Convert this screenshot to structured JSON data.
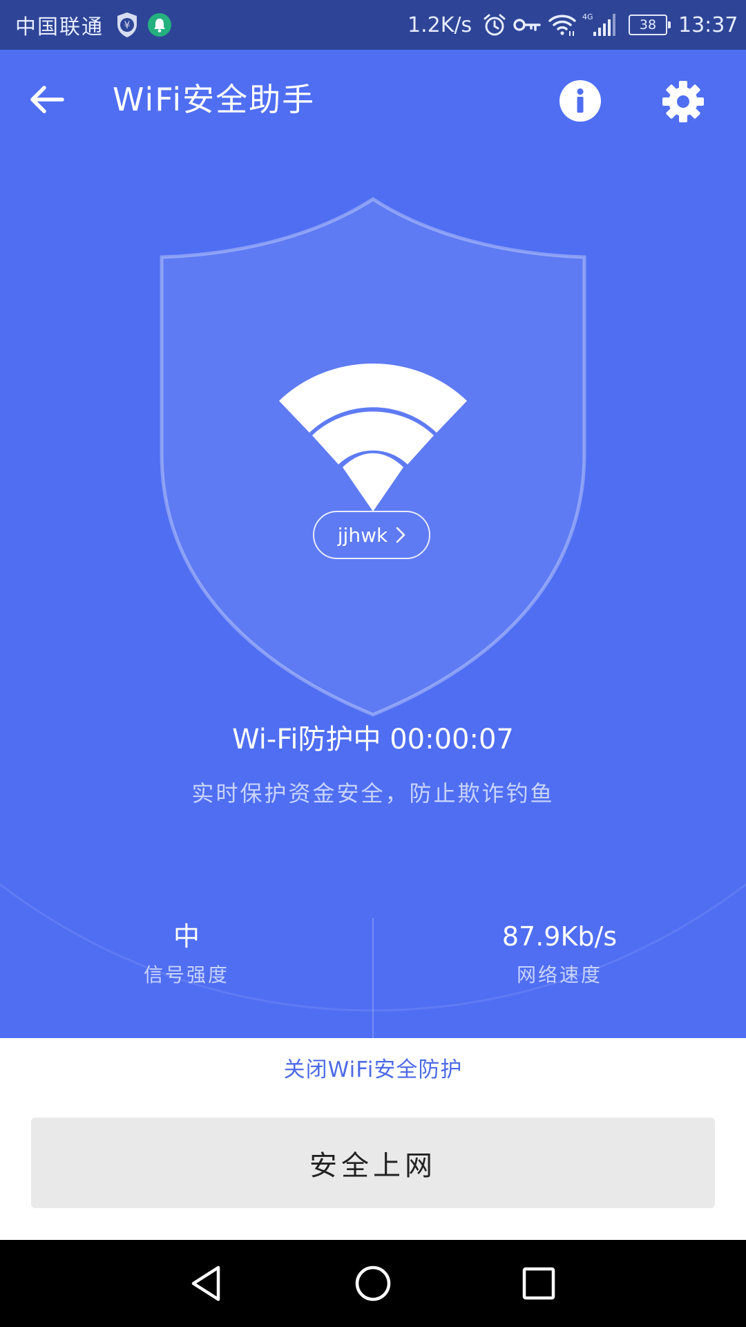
{
  "status_bar": {
    "carrier": "中国联通",
    "net_speed": "1.2K/s",
    "network_type": "4G",
    "battery": "38",
    "time": "13:37",
    "icons": [
      "shield-yuan-icon",
      "bell-icon",
      "alarm-icon",
      "key-icon",
      "wifi-icon",
      "cell-signal-icon"
    ]
  },
  "app_bar": {
    "title": "WiFi安全助手",
    "icons": [
      "back-arrow-icon",
      "info-icon",
      "gear-icon"
    ]
  },
  "shield": {
    "icon": "wifi-icon",
    "network_name": "jjhwk",
    "chevron": "chevron-right-icon"
  },
  "protection": {
    "status": "Wi-Fi防护中 00:00:07",
    "description": "实时保护资金安全，防止欺诈钓鱼"
  },
  "stats": {
    "signal": {
      "value": "中",
      "label": "信号强度"
    },
    "speed": {
      "value": "87.9Kb/s",
      "label": "网络速度"
    }
  },
  "actions": {
    "close_protection": "关闭WiFi安全防护",
    "safe_browse": "安全上网"
  },
  "nav_bar": {
    "icons": [
      "nav-back-icon",
      "nav-home-icon",
      "nav-recents-icon"
    ]
  },
  "colors": {
    "status_bar_bg": "#2e4597",
    "primary": "#4f6ef2",
    "link": "#4d6ae6",
    "button_bg": "#e9e9e9",
    "nav_bg": "#000000"
  }
}
